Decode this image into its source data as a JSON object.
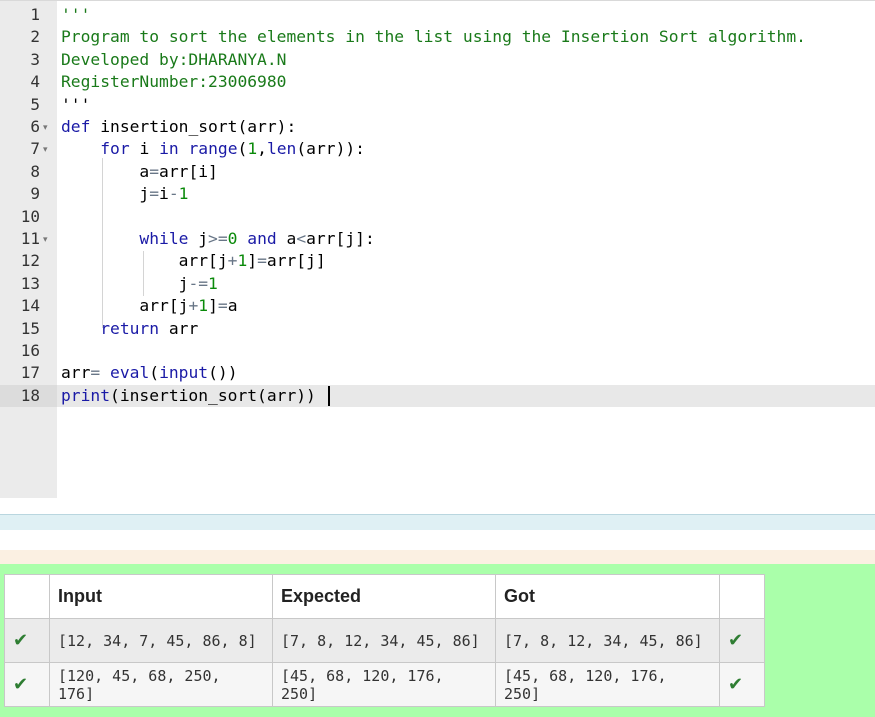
{
  "editor": {
    "line_numbers": [
      "1",
      "2",
      "3",
      "4",
      "5",
      "6",
      "7",
      "8",
      "9",
      "10",
      "11",
      "12",
      "13",
      "14",
      "15",
      "16",
      "17",
      "18"
    ],
    "fold_marker": "▾",
    "lines": [
      "'''",
      "Program to sort the elements in the list using the Insertion Sort algorithm.",
      "Developed by:DHARANYA.N",
      "RegisterNumber:23006980",
      "'''",
      "def insertion_sort(arr):",
      "    for i in range(1,len(arr)):",
      "        a=arr[i]",
      "        j=i-1",
      "",
      "        while j>=0 and a<arr[j]:",
      "            arr[j+1]=arr[j]",
      "            j-=1",
      "        arr[j+1]=a",
      "    return arr",
      "",
      "arr= eval(input())",
      "print(insertion_sort(arr))"
    ]
  },
  "results": {
    "headers": [
      "Input",
      "Expected",
      "Got"
    ],
    "rows": [
      {
        "status": "✔",
        "input": "[12, 34, 7, 45, 86, 8]",
        "expected": "[7, 8, 12, 34, 45, 86]",
        "got": "[7, 8, 12, 34, 45, 86]",
        "result": "✔"
      },
      {
        "status": "✔",
        "input": "[120, 45, 68, 250, 176]",
        "expected": "[45, 68, 120, 176, 250]",
        "got": "[45, 68, 120, 176, 250]",
        "result": "✔"
      }
    ]
  },
  "colors": {
    "pass_panel": "#aaffaa",
    "check": "#2e7d32",
    "keyword": "#1a1aa6",
    "string": "#1a7a1a"
  }
}
